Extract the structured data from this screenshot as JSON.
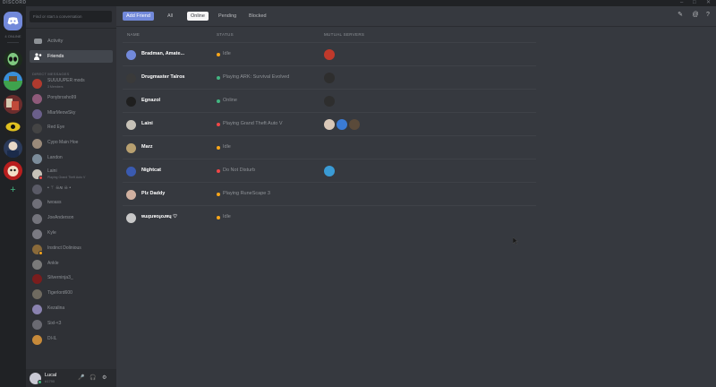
{
  "titlebar": {
    "brand": "DISCORD",
    "minimize": "–",
    "maximize": "□",
    "close": "✕"
  },
  "guilds": {
    "online_count": "4 ONLINE",
    "add": "+"
  },
  "sidebar": {
    "search_placeholder": "Find or start a conversation",
    "nav": [
      {
        "label": "Activity",
        "icon": "activity-icon"
      },
      {
        "label": "Friends",
        "icon": "friends-icon"
      }
    ],
    "dm_header": "DIRECT MESSAGES",
    "dms": [
      {
        "name": "SUUUUPER mods",
        "sub": "3 Members",
        "color": "#b03a2e",
        "status": ""
      },
      {
        "name": "Ponybrosho99",
        "sub": "",
        "color": "#8f5a7a",
        "status": ""
      },
      {
        "name": "MlarMeowSky",
        "sub": "",
        "color": "#6a5f8a",
        "status": ""
      },
      {
        "name": "Red Eye",
        "sub": "",
        "color": "#444444",
        "status": ""
      },
      {
        "name": "Cypo Main Hoe",
        "sub": "",
        "color": "#9a8a7a",
        "status": ""
      },
      {
        "name": "Landon",
        "sub": "",
        "color": "#7c8c9a",
        "status": ""
      },
      {
        "name": "Laini",
        "sub": "Playing Grand Theft Auto V",
        "color": "#c7c2b8",
        "status": "#f04747"
      },
      {
        "name": "• ⚚ ☠ʍ ☠ •",
        "sub": "",
        "color": "#5a5a66",
        "status": ""
      },
      {
        "name": "twoass",
        "sub": "",
        "color": "#6f6f78",
        "status": ""
      },
      {
        "name": "JoeAnderson",
        "sub": "",
        "color": "#74747c",
        "status": ""
      },
      {
        "name": "Kyle",
        "sub": "",
        "color": "#7a7a82",
        "status": ""
      },
      {
        "name": "Instinct Dolinious",
        "sub": "",
        "color": "#8a6a3a",
        "status": "#faa61a"
      },
      {
        "name": "Ankle",
        "sub": "",
        "color": "#7a7a7a",
        "status": ""
      },
      {
        "name": "Silverninja3_",
        "sub": "",
        "color": "#7a1d1d",
        "status": ""
      },
      {
        "name": "Tigerlord600",
        "sub": "",
        "color": "#6f6a60",
        "status": ""
      },
      {
        "name": "Kezalina",
        "sub": "",
        "color": "#8a82b0",
        "status": ""
      },
      {
        "name": "Sixl-<3",
        "sub": "",
        "color": "#6a6a72",
        "status": ""
      },
      {
        "name": "Dl-IL",
        "sub": "",
        "color": "#c78a3a",
        "status": ""
      }
    ],
    "user": {
      "name": "Lucal",
      "tag": "#1790",
      "mic": "🎤",
      "headphones": "🎧",
      "settings": "⚙"
    }
  },
  "main": {
    "tabs": [
      {
        "label": "Add Friend",
        "style": "add"
      },
      {
        "label": "All",
        "style": ""
      },
      {
        "label": "Online",
        "style": "sel"
      },
      {
        "label": "Pending",
        "style": ""
      },
      {
        "label": "Blocked",
        "style": ""
      }
    ],
    "columns": {
      "name": "NAME",
      "status": "STATUS",
      "mutual": "MUTUAL SERVERS"
    },
    "friends": [
      {
        "name": "Bradman, Amate...",
        "status": "Idle",
        "dot": "#faa61a",
        "avatar": "#7289da",
        "mutual": [
          "#c0392b"
        ]
      },
      {
        "name": "Drugmaster Talros",
        "status": "Playing ARK: Survival Evolved",
        "dot": "#43b581",
        "avatar": "#3a3a3a",
        "mutual": [
          "#2e2e2e"
        ]
      },
      {
        "name": "Egnazol",
        "status": "Online",
        "dot": "#43b581",
        "avatar": "#1f1f1f",
        "mutual": [
          "#2e2e2e"
        ]
      },
      {
        "name": "Laini",
        "status": "Playing Grand Theft Auto V",
        "dot": "#f04747",
        "avatar": "#c7c2b8",
        "mutual": [
          "#d9c8b8",
          "#3a7bd5",
          "#5a4a3a"
        ]
      },
      {
        "name": "Marz",
        "status": "Idle",
        "dot": "#faa61a",
        "avatar": "#b8a070",
        "mutual": []
      },
      {
        "name": "Nightcat",
        "status": "Do Not Disturb",
        "dot": "#f04747",
        "avatar": "#3a5ab0",
        "mutual": [
          "#3a9bd5"
        ]
      },
      {
        "name": "Plz Daddy",
        "status": "Playing RuneScape 3",
        "dot": "#faa61a",
        "avatar": "#d0b0a0",
        "mutual": []
      },
      {
        "name": "ɐɯpɹɐoɟoɹɐɥ ♡",
        "status": "Idle",
        "dot": "#faa61a",
        "avatar": "#c8c8c8",
        "mutual": []
      }
    ],
    "icons": {
      "new_dm": "✎",
      "mention": "@",
      "help": "?"
    }
  },
  "colors": {
    "blurple": "#7289da",
    "online": "#43b581",
    "idle": "#faa61a",
    "dnd": "#f04747"
  }
}
